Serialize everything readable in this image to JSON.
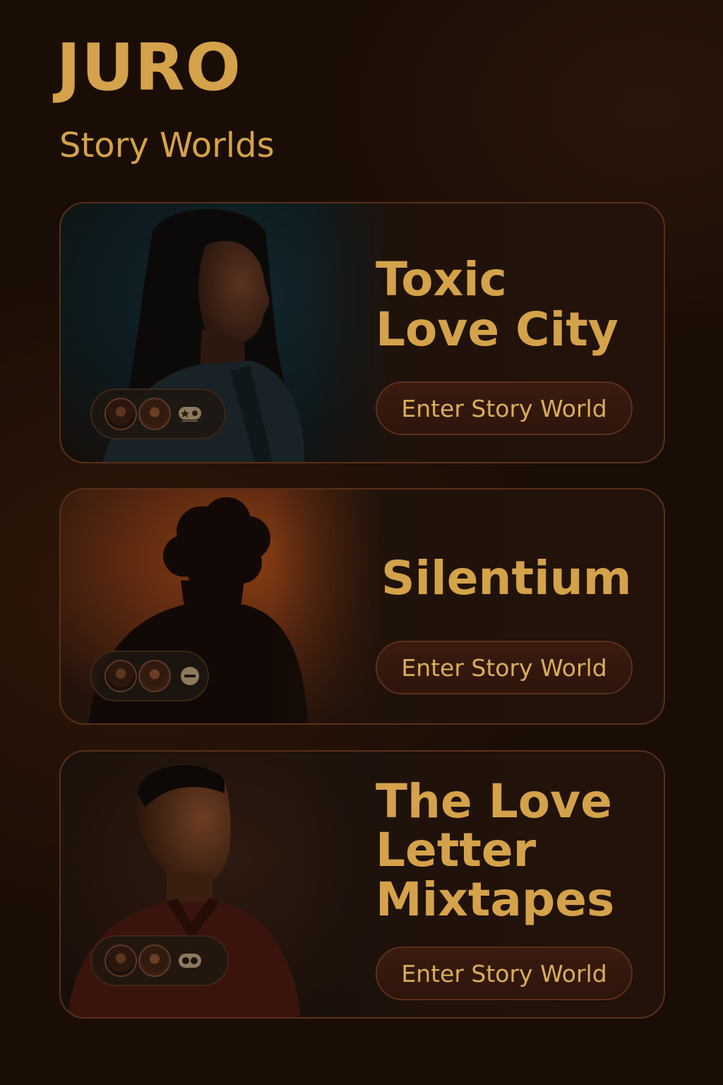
{
  "app": {
    "brand": "JURO",
    "section_title": "Story Worlds"
  },
  "colors": {
    "accent_gold": "#d4a24a",
    "background": "#1a0d06",
    "card_border": "#5a2f1a",
    "button_fill": "#35190d"
  },
  "worlds": [
    {
      "title": "Toxic\nLove City",
      "button_label": "Enter Story World",
      "participant_count": 2,
      "badge_icon": "game-controller-icon"
    },
    {
      "title": "Silentium",
      "button_label": "Enter Story World",
      "participant_count": 2,
      "badge_icon": "mute-icon"
    },
    {
      "title": "The Love\nLetter\nMixtapes",
      "button_label": "Enter Story World",
      "participant_count": 2,
      "badge_icon": "cassette-icon"
    }
  ]
}
